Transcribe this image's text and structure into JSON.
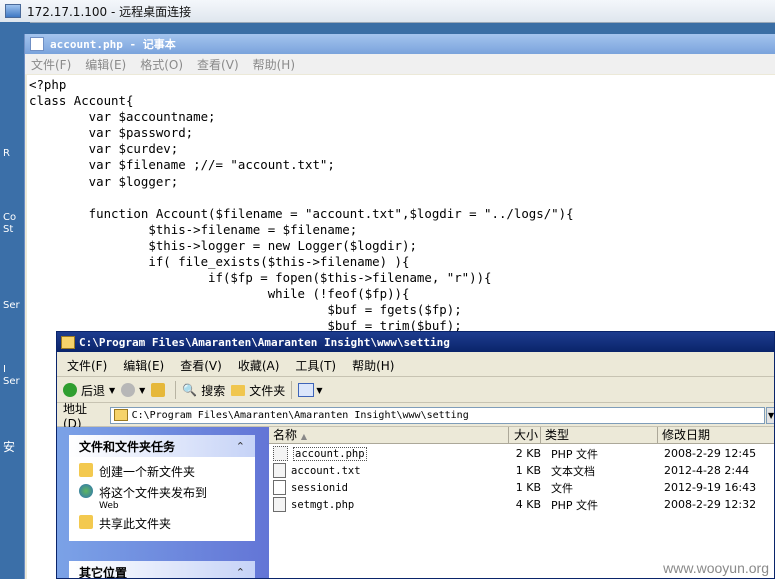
{
  "rdp": {
    "title": "172.17.1.100 - 远程桌面连接"
  },
  "desktop": {
    "labels": [
      "R",
      "Co",
      "St",
      "Ser",
      "I",
      "Ser",
      "安"
    ]
  },
  "notepad": {
    "title": "account.php - 记事本",
    "menu": [
      "文件(F)",
      "编辑(E)",
      "格式(O)",
      "查看(V)",
      "帮助(H)"
    ],
    "content": "<?php\nclass Account{\n        var $accountname;\n        var $password;\n        var $curdev;\n        var $filename ;//= \"account.txt\";\n        var $logger;\n\n        function Account($filename = \"account.txt\",$logdir = \"../logs/\"){\n                $this->filename = $filename;\n                $this->logger = new Logger($logdir);\n                if( file_exists($this->filename) ){\n                        if($fp = fopen($this->filename, \"r\")){\n                                while (!feof($fp)){\n                                        $buf = fgets($fp);\n                                        $buf = trim($buf);"
  },
  "explorer": {
    "title": "C:\\Program Files\\Amaranten\\Amaranten Insight\\www\\setting",
    "menu": [
      "文件(F)",
      "编辑(E)",
      "查看(V)",
      "收藏(A)",
      "工具(T)",
      "帮助(H)"
    ],
    "toolbar": {
      "back": "后退",
      "search": "搜索",
      "folders": "文件夹"
    },
    "address_label": "地址(D)",
    "address": "C:\\Program Files\\Amaranten\\Amaranten Insight\\www\\setting",
    "tasks_panel": {
      "title": "文件和文件夹任务",
      "items": [
        {
          "label": "创建一个新文件夹",
          "sub": ""
        },
        {
          "label": "将这个文件夹发布到",
          "sub": "Web"
        },
        {
          "label": "共享此文件夹",
          "sub": ""
        }
      ]
    },
    "other_panel": {
      "title": "其它位置"
    },
    "columns": {
      "name": "名称",
      "size": "大小",
      "type": "类型",
      "modified": "修改日期"
    },
    "files": [
      {
        "name": "account.php",
        "size": "2 KB",
        "type": "PHP 文件",
        "modified": "2008-2-29 12:45"
      },
      {
        "name": "account.txt",
        "size": "1 KB",
        "type": "文本文档",
        "modified": "2012-4-28 2:44"
      },
      {
        "name": "sessionid",
        "size": "1 KB",
        "type": "文件",
        "modified": "2012-9-19 16:43"
      },
      {
        "name": "setmgt.php",
        "size": "4 KB",
        "type": "PHP 文件",
        "modified": "2008-2-29 12:32"
      }
    ]
  },
  "watermark": "www.wooyun.org",
  "colors": {
    "xp_title": "#0a246a",
    "notepad_title": "#7aa3dc",
    "taskpane": "#6375d6"
  }
}
